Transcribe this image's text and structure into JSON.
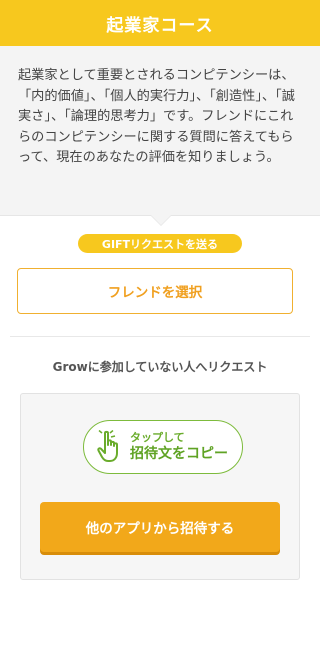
{
  "header": {
    "title": "起業家コース"
  },
  "intro": {
    "text": "起業家として重要とされるコンピテンシーは、「内的価値」、「個人的実行力」、「創造性」、「誠実さ」、「論理的思考力」です。フレンドにこれらのコンピテンシーに関する質問に答えてもらって、現在のあなたの評価を知りましょう。"
  },
  "gift": {
    "badge_label": "GIFTリクエストを送る",
    "select_friend_label": "フレンドを選択"
  },
  "invite": {
    "heading": "Growに参加していない人へリクエスト",
    "copy_small": "タップして",
    "copy_big": "招待文をコピー",
    "other_apps_label": "他のアプリから招待する"
  },
  "colors": {
    "brand_yellow": "#f7c81e",
    "orange": "#f2a81a",
    "green": "#7dbb3c"
  },
  "icons": {
    "tap": "hand-pointer-icon"
  }
}
